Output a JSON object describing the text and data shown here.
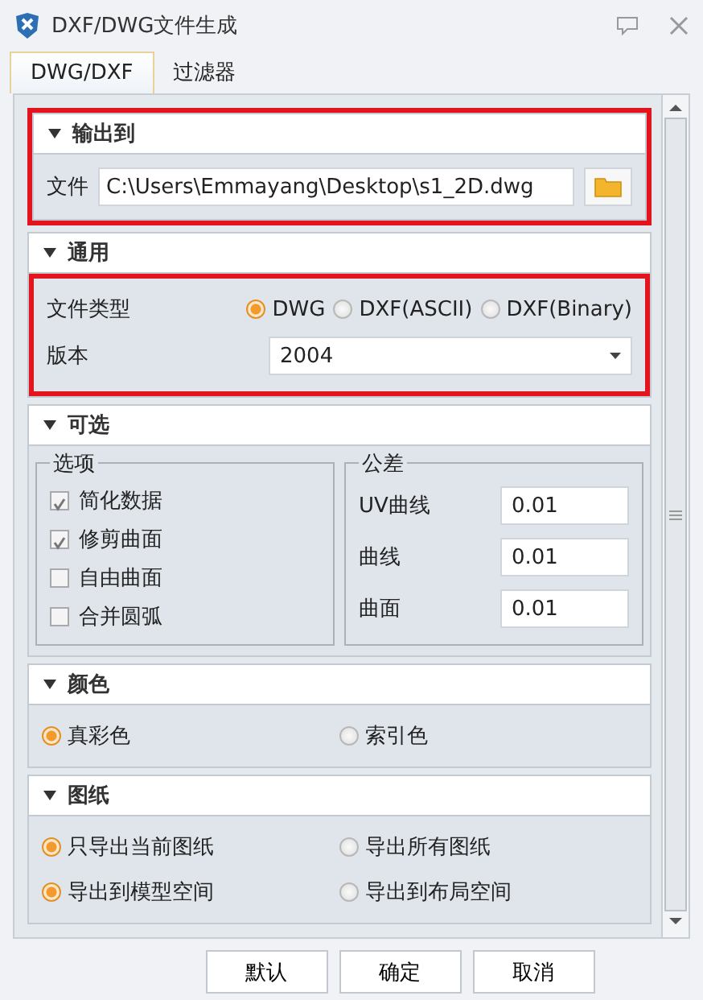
{
  "window": {
    "title": "DXF/DWG文件生成"
  },
  "tabs": [
    {
      "label": "DWG/DXF",
      "selected": true
    },
    {
      "label": "过滤器",
      "selected": false
    }
  ],
  "output": {
    "title": "输出到",
    "expanded": true,
    "highlighted": true,
    "file_label": "文件",
    "file_path": "C:\\Users\\Emmayang\\Desktop\\s1_2D.dwg"
  },
  "general": {
    "title": "通用",
    "expanded": true,
    "highlighted": true,
    "type_label": "文件类型",
    "types": [
      {
        "label": "DWG",
        "selected": true
      },
      {
        "label": "DXF(ASCII)",
        "selected": false
      },
      {
        "label": "DXF(Binary)",
        "selected": false
      }
    ],
    "version_label": "版本",
    "version": "2004"
  },
  "optional": {
    "title": "可选",
    "expanded": true,
    "options_title": "选项",
    "options": [
      {
        "label": "简化数据",
        "checked": true
      },
      {
        "label": "修剪曲面",
        "checked": true
      },
      {
        "label": "自由曲面",
        "checked": false
      },
      {
        "label": "合并圆弧",
        "checked": false
      }
    ],
    "tolerance_title": "公差",
    "tolerances": [
      {
        "label": "UV曲线",
        "value": "0.01"
      },
      {
        "label": "曲线",
        "value": "0.01"
      },
      {
        "label": "曲面",
        "value": "0.01"
      }
    ]
  },
  "color": {
    "title": "颜色",
    "expanded": true,
    "modes": [
      {
        "label": "真彩色",
        "selected": true
      },
      {
        "label": "索引色",
        "selected": false
      }
    ]
  },
  "drawing": {
    "title": "图纸",
    "expanded": true,
    "choices": [
      {
        "label": "只导出当前图纸",
        "selected": true
      },
      {
        "label": "导出所有图纸",
        "selected": false
      },
      {
        "label": "导出到模型空间",
        "selected": true
      },
      {
        "label": "导出到布局空间",
        "selected": false
      }
    ]
  },
  "buttons": [
    "默认",
    "确定",
    "取消"
  ]
}
